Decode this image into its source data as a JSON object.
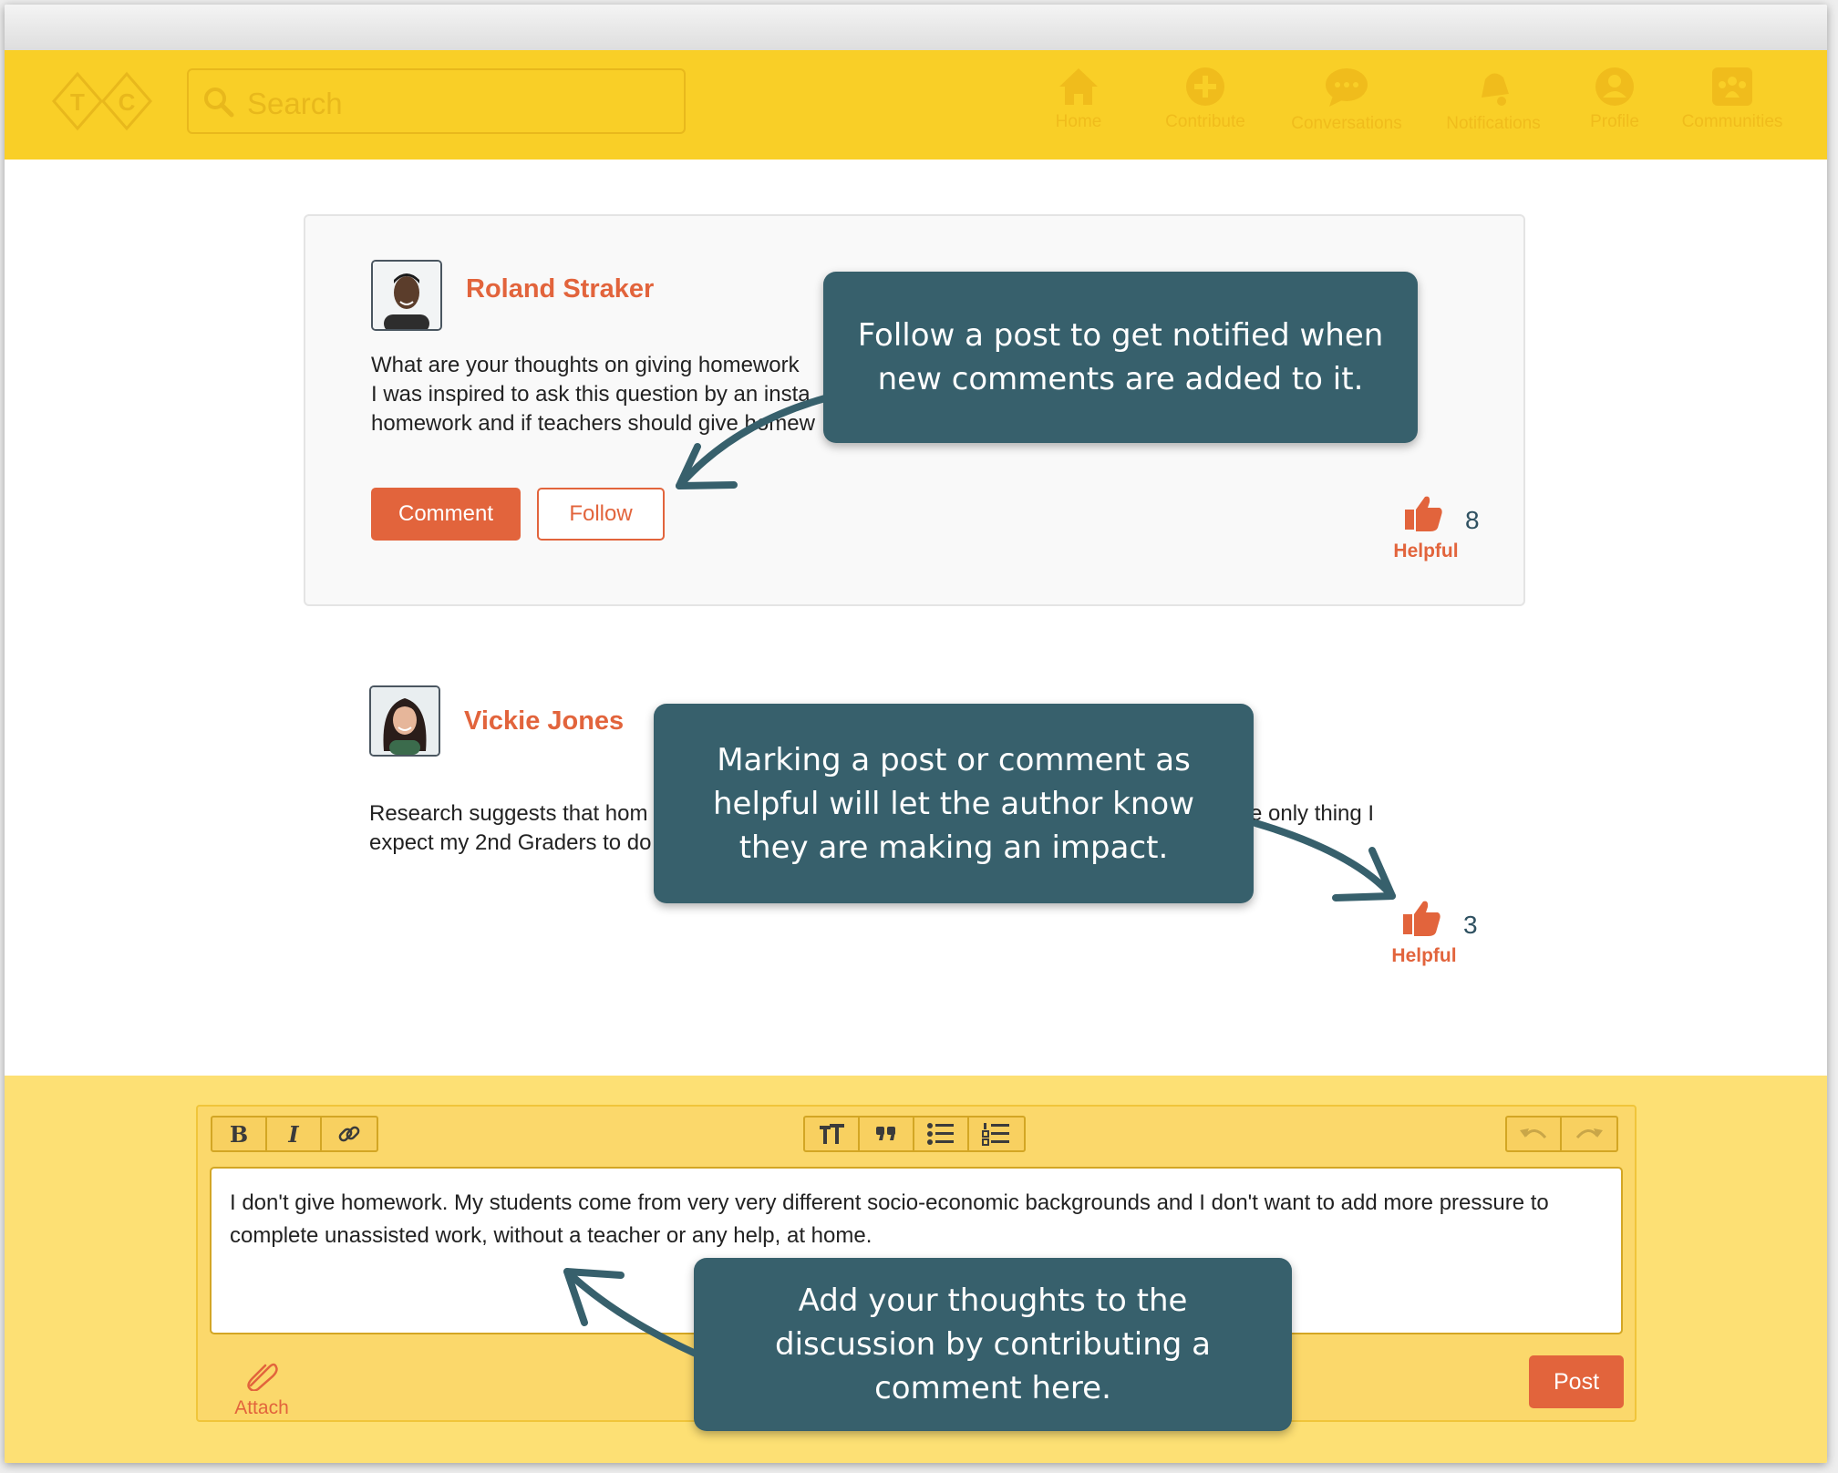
{
  "nav": {
    "search_placeholder": "Search",
    "items": [
      {
        "label": "Home",
        "icon": "home-icon"
      },
      {
        "label": "Contribute",
        "icon": "plus-circle-icon"
      },
      {
        "label": "Conversations",
        "icon": "chat-bubble-icon"
      },
      {
        "label": "Notifications",
        "icon": "bell-icon"
      },
      {
        "label": "Profile",
        "icon": "user-circle-icon"
      },
      {
        "label": "Communities",
        "icon": "group-icon"
      }
    ]
  },
  "post": {
    "author": "Roland Straker",
    "text_lines": [
      "What are your thoughts on giving homework",
      "I was inspired to ask this question by an insta",
      "homework and if teachers should give homew"
    ],
    "comment_label": "Comment",
    "follow_label": "Follow",
    "helpful_label": "Helpful",
    "helpful_count": "8"
  },
  "comment": {
    "author": "Vickie Jones",
    "text_lines_left": [
      "Research suggests that hom",
      "expect my 2nd Graders to do"
    ],
    "text_right": "e only thing I",
    "helpful_label": "Helpful",
    "helpful_count": "3"
  },
  "editor": {
    "toolbar": {
      "bold": "B",
      "italic": "I"
    },
    "value": "I don't give homework. My students come from very very different socio-economic backgrounds and I don't want to add more pressure to complete unassisted work, without a teacher or any help, at home.",
    "attach_label": "Attach",
    "post_label": "Post"
  },
  "callouts": {
    "follow": "Follow a post to get notified when new comments are added to it.",
    "helpful": "Marking a post or comment as helpful will let the author know they are making an impact.",
    "contribute": "Add your thoughts to the discussion by contributing a comment here."
  },
  "colors": {
    "nav_yellow": "#f9cf27",
    "accent_orange": "#e2643c",
    "callout_teal": "#37606c",
    "bottom_yellow": "#fde074"
  }
}
